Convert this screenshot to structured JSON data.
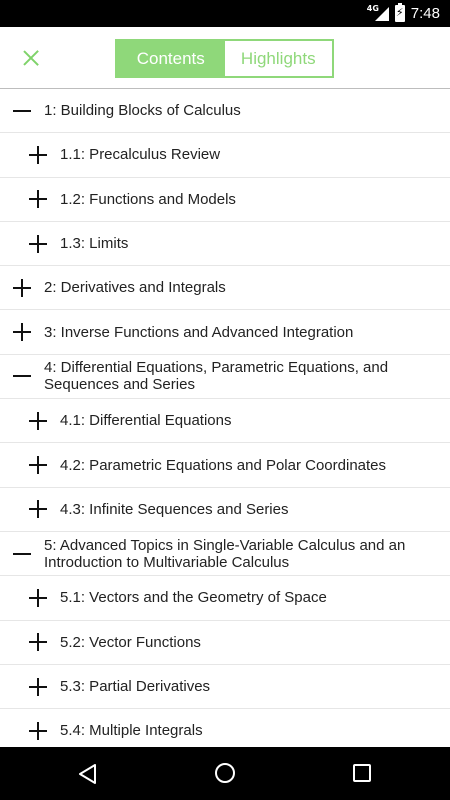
{
  "status_bar": {
    "network": "4G",
    "time": "7:48"
  },
  "toolbar": {
    "tabs": [
      {
        "label": "Contents"
      },
      {
        "label": "Highlights"
      }
    ],
    "active_tab": "Contents"
  },
  "colors": {
    "accent": "#8fd87a",
    "close_icon": "#7fd36a"
  },
  "toc": {
    "items": [
      {
        "label": "1: Building Blocks of Calculus",
        "level": 0,
        "state": "expanded"
      },
      {
        "label": "1.1: Precalculus Review",
        "level": 1,
        "state": "collapsed"
      },
      {
        "label": "1.2: Functions and Models",
        "level": 1,
        "state": "collapsed"
      },
      {
        "label": "1.3: Limits",
        "level": 1,
        "state": "collapsed"
      },
      {
        "label": "2: Derivatives and Integrals",
        "level": 0,
        "state": "collapsed"
      },
      {
        "label": "3: Inverse Functions and Advanced Integration",
        "level": 0,
        "state": "collapsed"
      },
      {
        "label": "4: Differential Equations, Parametric Equations, and Sequences and Series",
        "level": 0,
        "state": "expanded"
      },
      {
        "label": "4.1: Differential Equations",
        "level": 1,
        "state": "collapsed"
      },
      {
        "label": "4.2: Parametric Equations and Polar Coordinates",
        "level": 1,
        "state": "collapsed"
      },
      {
        "label": "4.3: Infinite Sequences and Series",
        "level": 1,
        "state": "collapsed"
      },
      {
        "label": "5: Advanced Topics in Single-Variable Calculus and an Introduction to Multivariable Calculus",
        "level": 0,
        "state": "expanded"
      },
      {
        "label": "5.1: Vectors and the Geometry of Space",
        "level": 1,
        "state": "collapsed"
      },
      {
        "label": "5.2: Vector Functions",
        "level": 1,
        "state": "collapsed"
      },
      {
        "label": "5.3: Partial Derivatives",
        "level": 1,
        "state": "collapsed"
      },
      {
        "label": "5.4: Multiple Integrals",
        "level": 1,
        "state": "collapsed"
      }
    ]
  }
}
